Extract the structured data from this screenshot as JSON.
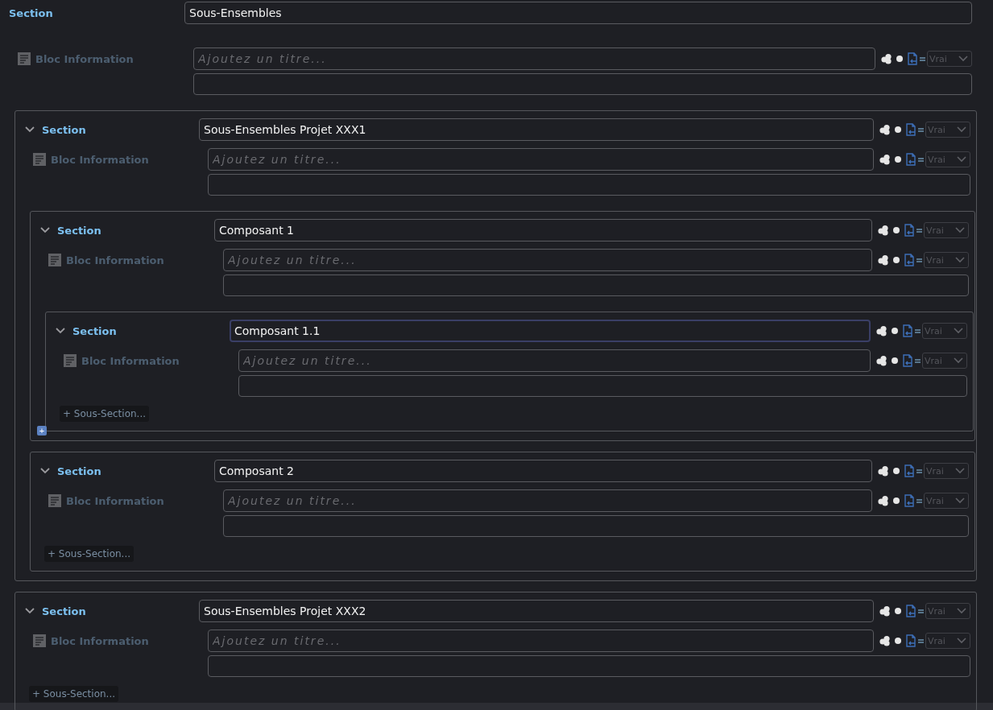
{
  "section": {
    "label": "Section",
    "title": "Sous-Ensembles",
    "focused": false,
    "info": {
      "label": "Bloc Information",
      "placeholder": "Ajoutez un titre...",
      "select": "Vrai"
    },
    "children": [
      {
        "label": "Section",
        "expanded": true,
        "title": "Sous-Ensembles Projet XXX1",
        "focused": false,
        "select": "Vrai",
        "info": {
          "label": "Bloc Information",
          "placeholder": "Ajoutez un titre...",
          "select": "Vrai"
        },
        "children": [
          {
            "label": "Section",
            "expanded": true,
            "title": "Composant 1",
            "focused": false,
            "select": "Vrai",
            "info": {
              "label": "Bloc Information",
              "placeholder": "Ajoutez un titre...",
              "select": "Vrai"
            },
            "children": [
              {
                "label": "Section",
                "expanded": true,
                "title": "Composant 1.1",
                "focused": true,
                "select": "Vrai",
                "info": {
                  "label": "Bloc Information",
                  "placeholder": "Ajoutez un titre...",
                  "select": "Vrai"
                },
                "add_button": "+ Sous-Section...",
                "corner_badge": "+"
              }
            ]
          },
          {
            "label": "Section",
            "expanded": true,
            "title": "Composant 2",
            "focused": false,
            "select": "Vrai",
            "info": {
              "label": "Bloc Information",
              "placeholder": "Ajoutez un titre...",
              "select": "Vrai"
            },
            "add_button": "+ Sous-Section..."
          }
        ]
      },
      {
        "label": "Section",
        "expanded": true,
        "title": "Sous-Ensembles Projet XXX2",
        "focused": false,
        "select": "Vrai",
        "info": {
          "label": "Bloc Information",
          "placeholder": "Ajoutez un titre...",
          "select": "Vrai"
        },
        "add_button": "+ Sous-Section..."
      }
    ]
  }
}
